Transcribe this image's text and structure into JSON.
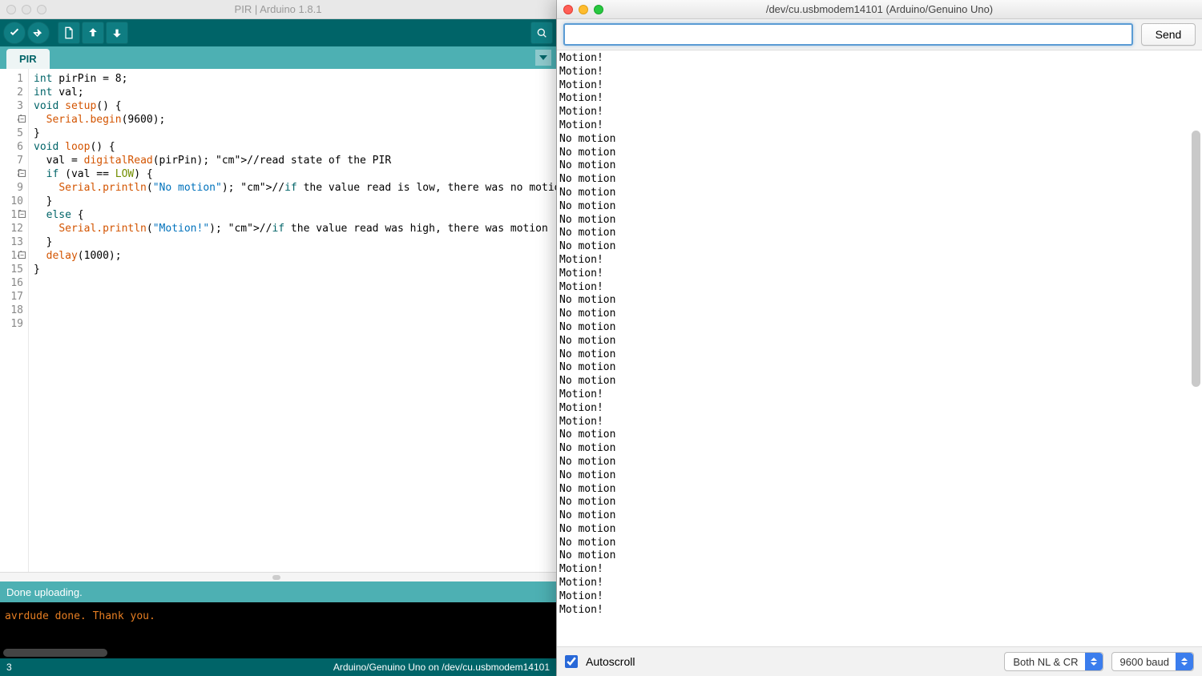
{
  "ide": {
    "title": "PIR | Arduino 1.8.1",
    "tab": "PIR",
    "toolbar_icons": [
      "verify",
      "upload",
      "new",
      "open",
      "save",
      "serial-monitor"
    ],
    "code_lines": [
      {
        "n": 1,
        "raw": "int pirPin = 8;",
        "fold": false
      },
      {
        "n": 2,
        "raw": "int val;",
        "fold": false
      },
      {
        "n": 3,
        "raw": "",
        "fold": false
      },
      {
        "n": 4,
        "raw": "void setup() {",
        "fold": true
      },
      {
        "n": 5,
        "raw": "  Serial.begin(9600);",
        "fold": false
      },
      {
        "n": 6,
        "raw": "}",
        "fold": false
      },
      {
        "n": 7,
        "raw": "",
        "fold": false
      },
      {
        "n": 8,
        "raw": "void loop() {",
        "fold": true
      },
      {
        "n": 9,
        "raw": "  val = digitalRead(pirPin); //read state of the PIR",
        "fold": false
      },
      {
        "n": 10,
        "raw": "",
        "fold": false
      },
      {
        "n": 11,
        "raw": "  if (val == LOW) {",
        "fold": true
      },
      {
        "n": 12,
        "raw": "    Serial.println(\"No motion\"); //if the value read is low, there was no motion",
        "fold": false
      },
      {
        "n": 13,
        "raw": "  }",
        "fold": false
      },
      {
        "n": 14,
        "raw": "  else {",
        "fold": true
      },
      {
        "n": 15,
        "raw": "    Serial.println(\"Motion!\"); //if the value read was high, there was motion",
        "fold": false
      },
      {
        "n": 16,
        "raw": "  }",
        "fold": false
      },
      {
        "n": 17,
        "raw": "",
        "fold": false
      },
      {
        "n": 18,
        "raw": "  delay(1000);",
        "fold": false
      },
      {
        "n": 19,
        "raw": "}",
        "fold": false
      }
    ],
    "status": "Done uploading.",
    "console": "avrdude done.  Thank you.",
    "footer_left": "3",
    "footer_right": "Arduino/Genuino Uno on /dev/cu.usbmodem14101"
  },
  "serial": {
    "title": "/dev/cu.usbmodem14101 (Arduino/Genuino Uno)",
    "input": "",
    "send_label": "Send",
    "autoscroll": true,
    "autoscroll_label": "Autoscroll",
    "line_ending_selected": "Both NL & CR",
    "baud_selected": "9600 baud",
    "lines": [
      "Motion!",
      "Motion!",
      "Motion!",
      "Motion!",
      "Motion!",
      "Motion!",
      "No motion",
      "No motion",
      "No motion",
      "No motion",
      "No motion",
      "No motion",
      "No motion",
      "No motion",
      "No motion",
      "Motion!",
      "Motion!",
      "Motion!",
      "No motion",
      "No motion",
      "No motion",
      "No motion",
      "No motion",
      "No motion",
      "No motion",
      "Motion!",
      "Motion!",
      "Motion!",
      "No motion",
      "No motion",
      "No motion",
      "No motion",
      "No motion",
      "No motion",
      "No motion",
      "No motion",
      "No motion",
      "No motion",
      "Motion!",
      "Motion!",
      "Motion!",
      "Motion!"
    ]
  }
}
